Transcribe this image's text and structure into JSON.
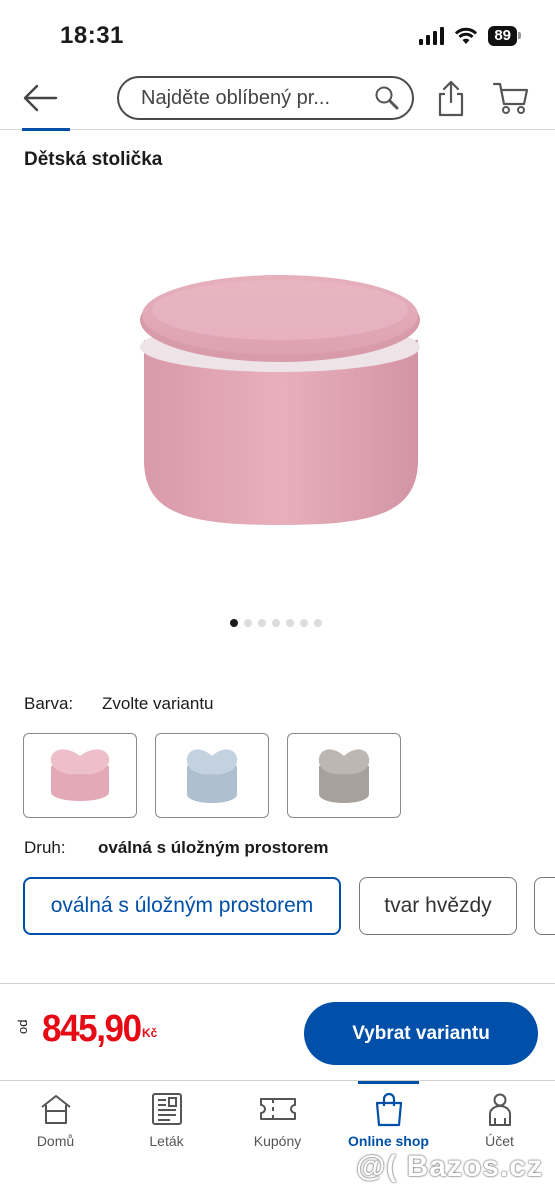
{
  "status_bar": {
    "time": "18:31",
    "battery": "89"
  },
  "header": {
    "search_placeholder": "Najděte oblíbený pr..."
  },
  "product": {
    "title": "Dětská stolička",
    "gallery_count": 7,
    "gallery_active": 0
  },
  "color_picker": {
    "label": "Barva:",
    "value": "Zvolte variantu",
    "swatches": [
      {
        "name": "pink",
        "color": "#e6b3bf"
      },
      {
        "name": "blue",
        "color": "#b9c8d6"
      },
      {
        "name": "grey",
        "color": "#b5b0aa"
      }
    ]
  },
  "type_picker": {
    "label": "Druh:",
    "value": "oválná s úložným prostorem",
    "options": [
      "oválná s úložným prostorem",
      "tvar hvězdy"
    ]
  },
  "price": {
    "prefix": "od",
    "amount": "845,90",
    "currency": "Kč"
  },
  "cta": {
    "label": "Vybrat variantu"
  },
  "tabs": [
    {
      "label": "Domů",
      "icon": "home-icon"
    },
    {
      "label": "Leták",
      "icon": "leaflet-icon"
    },
    {
      "label": "Kupóny",
      "icon": "coupon-icon"
    },
    {
      "label": "Online shop",
      "icon": "shopping-bag-icon",
      "active": true
    },
    {
      "label": "Účet",
      "icon": "account-icon"
    }
  ],
  "watermark": "@( Bazos.cz",
  "colors": {
    "brand_blue": "#0050aa",
    "price_red": "#e60a14"
  }
}
